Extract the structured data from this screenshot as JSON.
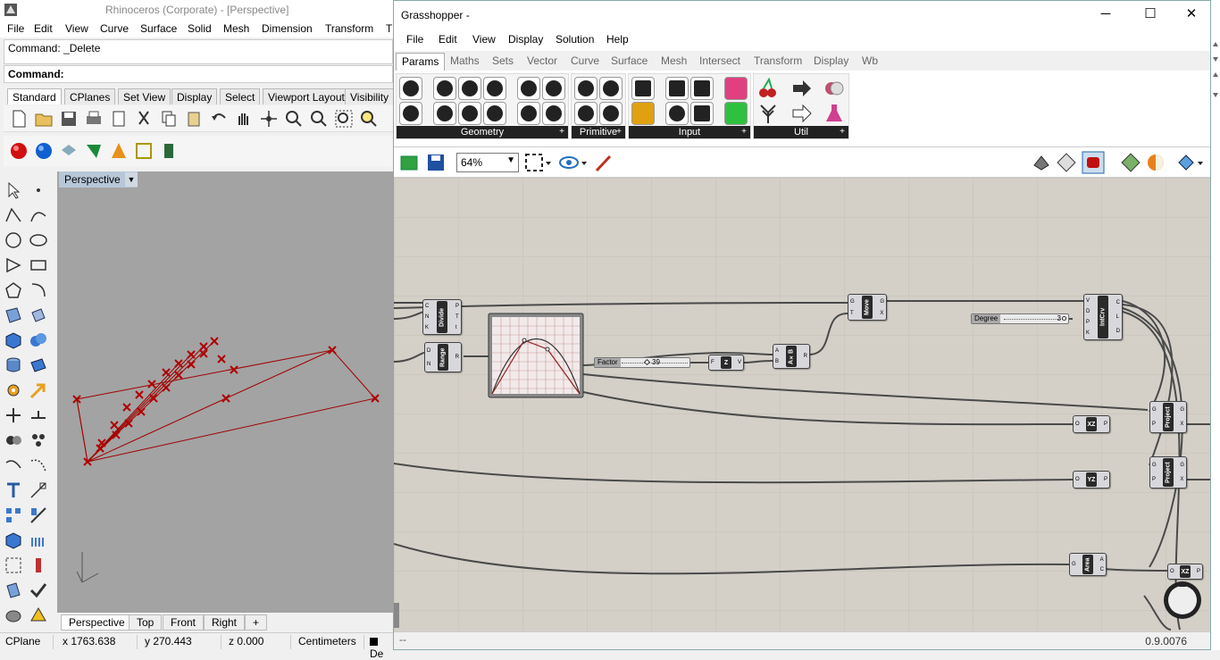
{
  "rhino": {
    "title": "Rhinoceros (Corporate) - [Perspective]",
    "menu": [
      "File",
      "Edit",
      "View",
      "Curve",
      "Surface",
      "Solid",
      "Mesh",
      "Dimension",
      "Transform",
      "T"
    ],
    "command_history": "Command: _Delete",
    "command_prompt": "Command:",
    "toolbar_tabs": [
      "Standard",
      "CPlanes",
      "Set View",
      "Display",
      "Select",
      "Viewport Layout",
      "Visibility"
    ],
    "viewport_label": "Perspective",
    "viewport_tabs": [
      "Perspective",
      "Top",
      "Front",
      "Right"
    ],
    "add_tab": "+",
    "status": {
      "cplane": "CPlane",
      "x": "x 1763.638",
      "y": "y 270.443",
      "z": "z 0.000",
      "units": "Centimeters",
      "layer": "De"
    }
  },
  "grasshopper": {
    "title": "Grasshopper -",
    "menu": [
      "File",
      "Edit",
      "View",
      "Display",
      "Solution",
      "Help"
    ],
    "category_tabs": [
      "Params",
      "Maths",
      "Sets",
      "Vector",
      "Curve",
      "Surface",
      "Mesh",
      "Intersect",
      "Transform",
      "Display",
      "Wb"
    ],
    "active_tab": "Params",
    "ribbon_groups": [
      "Geometry",
      "Primitive",
      "Input",
      "Util"
    ],
    "zoom": "64%",
    "components": {
      "divide": {
        "name": "Divide",
        "inputs": [
          "C",
          "N",
          "K"
        ],
        "outputs": [
          "P",
          "T",
          "t"
        ]
      },
      "range": {
        "name": "Range",
        "inputs": [
          "D",
          "N"
        ],
        "outputs": [
          "R"
        ]
      },
      "move": {
        "name": "Move",
        "inputs": [
          "G",
          "T"
        ],
        "outputs": [
          "G",
          "X"
        ]
      },
      "intcrv": {
        "name": "IntCrv",
        "inputs": [
          "V",
          "D",
          "P",
          "K"
        ],
        "outputs": [
          "C",
          "L",
          "D"
        ]
      },
      "z": {
        "name": "Z",
        "inputs": [
          "F"
        ],
        "outputs": [
          "V"
        ]
      },
      "axb": {
        "name": "A×B",
        "inputs": [
          "A",
          "B"
        ],
        "outputs": [
          "R"
        ]
      },
      "xz": {
        "name": "XZ",
        "inputs": [
          "O"
        ],
        "outputs": [
          "P"
        ]
      },
      "yz": {
        "name": "YZ",
        "inputs": [
          "O"
        ],
        "outputs": [
          "P"
        ]
      },
      "project1": {
        "name": "Project",
        "inputs": [
          "G",
          "P"
        ],
        "outputs": [
          "G",
          "X"
        ]
      },
      "project2": {
        "name": "Project",
        "inputs": [
          "G",
          "P"
        ],
        "outputs": [
          "G",
          "X"
        ]
      },
      "area": {
        "name": "Area",
        "inputs": [
          "G"
        ],
        "outputs": [
          "A",
          "C"
        ]
      },
      "xz2": {
        "name": "XZ",
        "inputs": [
          "O"
        ],
        "outputs": [
          "P"
        ]
      }
    },
    "sliders": {
      "degree": {
        "label": "Degree",
        "value": "3"
      },
      "factor": {
        "label": "Factor",
        "value": "39"
      }
    },
    "version": "0.9.0076",
    "status_left": "--"
  },
  "colors": {
    "canvas": "#d4d0c8",
    "viewport": "#a3a3a3",
    "curve_red": "#b00000",
    "component": "#9a9aa4"
  }
}
